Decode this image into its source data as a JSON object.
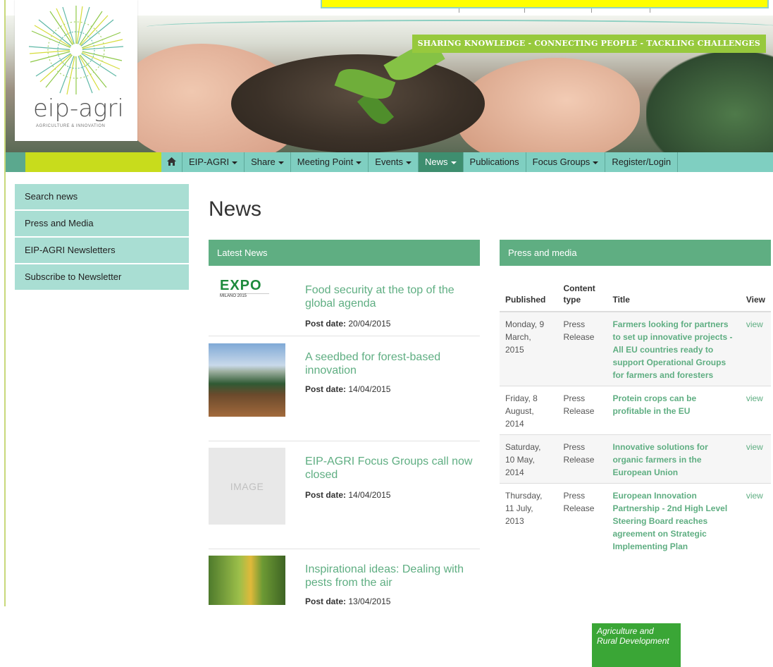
{
  "colors": {
    "accent_green": "#5fae82",
    "nav_teal": "#7fcfc1",
    "lime": "#c8dc1c",
    "sidebar": "#a9ded3",
    "dg_green": "#3aa636"
  },
  "logo": {
    "brand": "eip-agri",
    "sub": "AGRICULTURE & INNOVATION"
  },
  "banner": {
    "tagline": "SHARING KNOWLEDGE - CONNECTING PEOPLE - TACKLING CHALLENGES"
  },
  "nav": {
    "home_icon": "home-icon",
    "items": [
      {
        "label": "EIP-AGRI",
        "caret": true
      },
      {
        "label": "Share",
        "caret": true
      },
      {
        "label": "Meeting Point",
        "caret": true
      },
      {
        "label": "Events",
        "caret": true
      },
      {
        "label": "News",
        "caret": true,
        "active": true
      },
      {
        "label": "Publications",
        "caret": false
      },
      {
        "label": "Focus Groups",
        "caret": true
      },
      {
        "label": "Register/Login",
        "caret": false
      }
    ]
  },
  "sidebar": {
    "items": [
      {
        "label": "Search news"
      },
      {
        "label": "Press and Media"
      },
      {
        "label": "EIP-AGRI Newsletters"
      },
      {
        "label": "Subscribe to Newsletter"
      }
    ]
  },
  "main": {
    "title": "News",
    "latest": {
      "heading": "Latest News",
      "date_label": "Post date:",
      "items": [
        {
          "title": "Food security at the top of the global agenda",
          "date": "20/04/2015",
          "thumb": "expo"
        },
        {
          "title": "A seedbed for forest-based innovation",
          "date": "14/04/2015",
          "thumb": "forest"
        },
        {
          "title": "EIP-AGRI Focus Groups call now closed",
          "date": "14/04/2015",
          "thumb": "placeholder",
          "placeholder_text": "IMAGE"
        },
        {
          "title": "Inspirational ideas: Dealing with pests from the air",
          "date": "13/04/2015",
          "thumb": "corn"
        }
      ],
      "expo_logo": {
        "word": "EXPO",
        "sub": "MILANO 2015"
      }
    },
    "press": {
      "heading": "Press and media",
      "columns": [
        "Published",
        "Content type",
        "Title",
        "View"
      ],
      "rows": [
        {
          "published": "Monday, 9 March, 2015",
          "type": "Press Release",
          "title": "Farmers looking for partners to set up innovative projects - All EU countries ready to support Operational Groups for farmers and foresters",
          "view": "view"
        },
        {
          "published": "Friday, 8 August, 2014",
          "type": "Press Release",
          "title": "Protein crops can be profitable in the EU",
          "view": "view"
        },
        {
          "published": "Saturday, 10 May, 2014",
          "type": "Press Release",
          "title": "Innovative solutions for organic farmers in the European Union",
          "view": "view"
        },
        {
          "published": "Thursday, 11 July, 2013",
          "type": "Press Release",
          "title": "European Innovation Partnership - 2nd High Level Steering Board reaches agreement on Strategic Implementing Plan",
          "view": "view"
        }
      ]
    }
  },
  "footer": {
    "dg_badge": "Agriculture and Rural Development"
  }
}
